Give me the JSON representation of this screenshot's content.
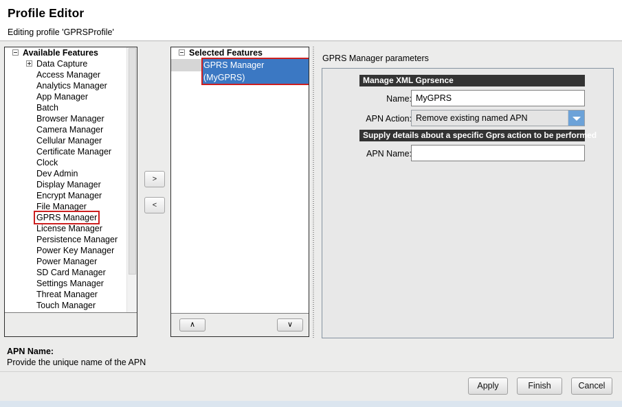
{
  "header": {
    "title": "Profile Editor",
    "subtitle": "Editing profile 'GPRSProfile'"
  },
  "available_features": {
    "root_label": "Available Features",
    "items": [
      {
        "label": "Data Capture",
        "expandable": true,
        "highlighted": false
      },
      {
        "label": "Access Manager",
        "expandable": false,
        "highlighted": false
      },
      {
        "label": "Analytics Manager",
        "expandable": false,
        "highlighted": false
      },
      {
        "label": "App Manager",
        "expandable": false,
        "highlighted": false
      },
      {
        "label": "Batch",
        "expandable": false,
        "highlighted": false
      },
      {
        "label": "Browser Manager",
        "expandable": false,
        "highlighted": false
      },
      {
        "label": "Camera Manager",
        "expandable": false,
        "highlighted": false
      },
      {
        "label": "Cellular Manager",
        "expandable": false,
        "highlighted": false
      },
      {
        "label": "Certificate Manager",
        "expandable": false,
        "highlighted": false
      },
      {
        "label": "Clock",
        "expandable": false,
        "highlighted": false
      },
      {
        "label": "Dev Admin",
        "expandable": false,
        "highlighted": false
      },
      {
        "label": "Display Manager",
        "expandable": false,
        "highlighted": false
      },
      {
        "label": "Encrypt Manager",
        "expandable": false,
        "highlighted": false
      },
      {
        "label": "File Manager",
        "expandable": false,
        "highlighted": false
      },
      {
        "label": "GPRS Manager",
        "expandable": false,
        "highlighted": true
      },
      {
        "label": "License Manager",
        "expandable": false,
        "highlighted": false
      },
      {
        "label": "Persistence Manager",
        "expandable": false,
        "highlighted": false
      },
      {
        "label": "Power Key Manager",
        "expandable": false,
        "highlighted": false
      },
      {
        "label": "Power Manager",
        "expandable": false,
        "highlighted": false
      },
      {
        "label": "SD Card Manager",
        "expandable": false,
        "highlighted": false
      },
      {
        "label": "Settings Manager",
        "expandable": false,
        "highlighted": false
      },
      {
        "label": "Threat Manager",
        "expandable": false,
        "highlighted": false
      },
      {
        "label": "Touch Manager",
        "expandable": false,
        "highlighted": false
      }
    ]
  },
  "transfer": {
    "add_label": ">",
    "remove_label": "<"
  },
  "selected_features": {
    "root_label": "Selected Features",
    "items": [
      {
        "label": "GPRS Manager (MyGPRS)",
        "selected": true
      }
    ],
    "move_up_label": "∧",
    "move_down_label": "∨"
  },
  "parameters": {
    "title": "GPRS Manager parameters",
    "sections": [
      {
        "header": "Manage XML Gprsence"
      },
      {
        "header": "Supply details about a specific Gprs action to be performed"
      }
    ],
    "fields": {
      "name_label": "Name:",
      "name_value": "MyGPRS",
      "apn_action_label": "APN Action:",
      "apn_action_value": "Remove existing named APN",
      "apn_name_label": "APN Name:",
      "apn_name_value": "",
      "apn_name_placeholder": ""
    }
  },
  "help": {
    "title": "APN Name:",
    "text": "Provide the unique name of the APN"
  },
  "footer": {
    "apply_label": "Apply",
    "finish_label": "Finish",
    "cancel_label": "Cancel"
  },
  "colors": {
    "annotation_red": "#cc1f1f",
    "selection_blue": "#3b78c3",
    "section_header_bg": "#333333",
    "combo_button_blue": "#6ca2d8"
  }
}
